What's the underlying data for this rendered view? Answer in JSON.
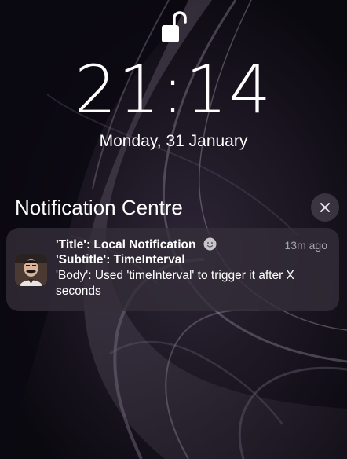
{
  "lock_screen": {
    "time": "21:14",
    "date": "Monday, 31 January",
    "lock_icon": "unlocked-padlock-icon"
  },
  "notification_centre": {
    "title": "Notification Centre",
    "close_icon": "close-icon"
  },
  "notification": {
    "app_icon": "app-avatar-icon",
    "title": "'Title': Local Notification",
    "emoji_icon": "smiling-face-icon",
    "timestamp": "13m ago",
    "subtitle": "'Subtitle': TimeInterval",
    "body": "'Body': Used 'timeInterval' to trigger it after X seconds"
  },
  "colors": {
    "background": "#0d0a12",
    "card": "#342e3a",
    "text": "#ffffff",
    "secondary_text": "#a8a4ad"
  }
}
